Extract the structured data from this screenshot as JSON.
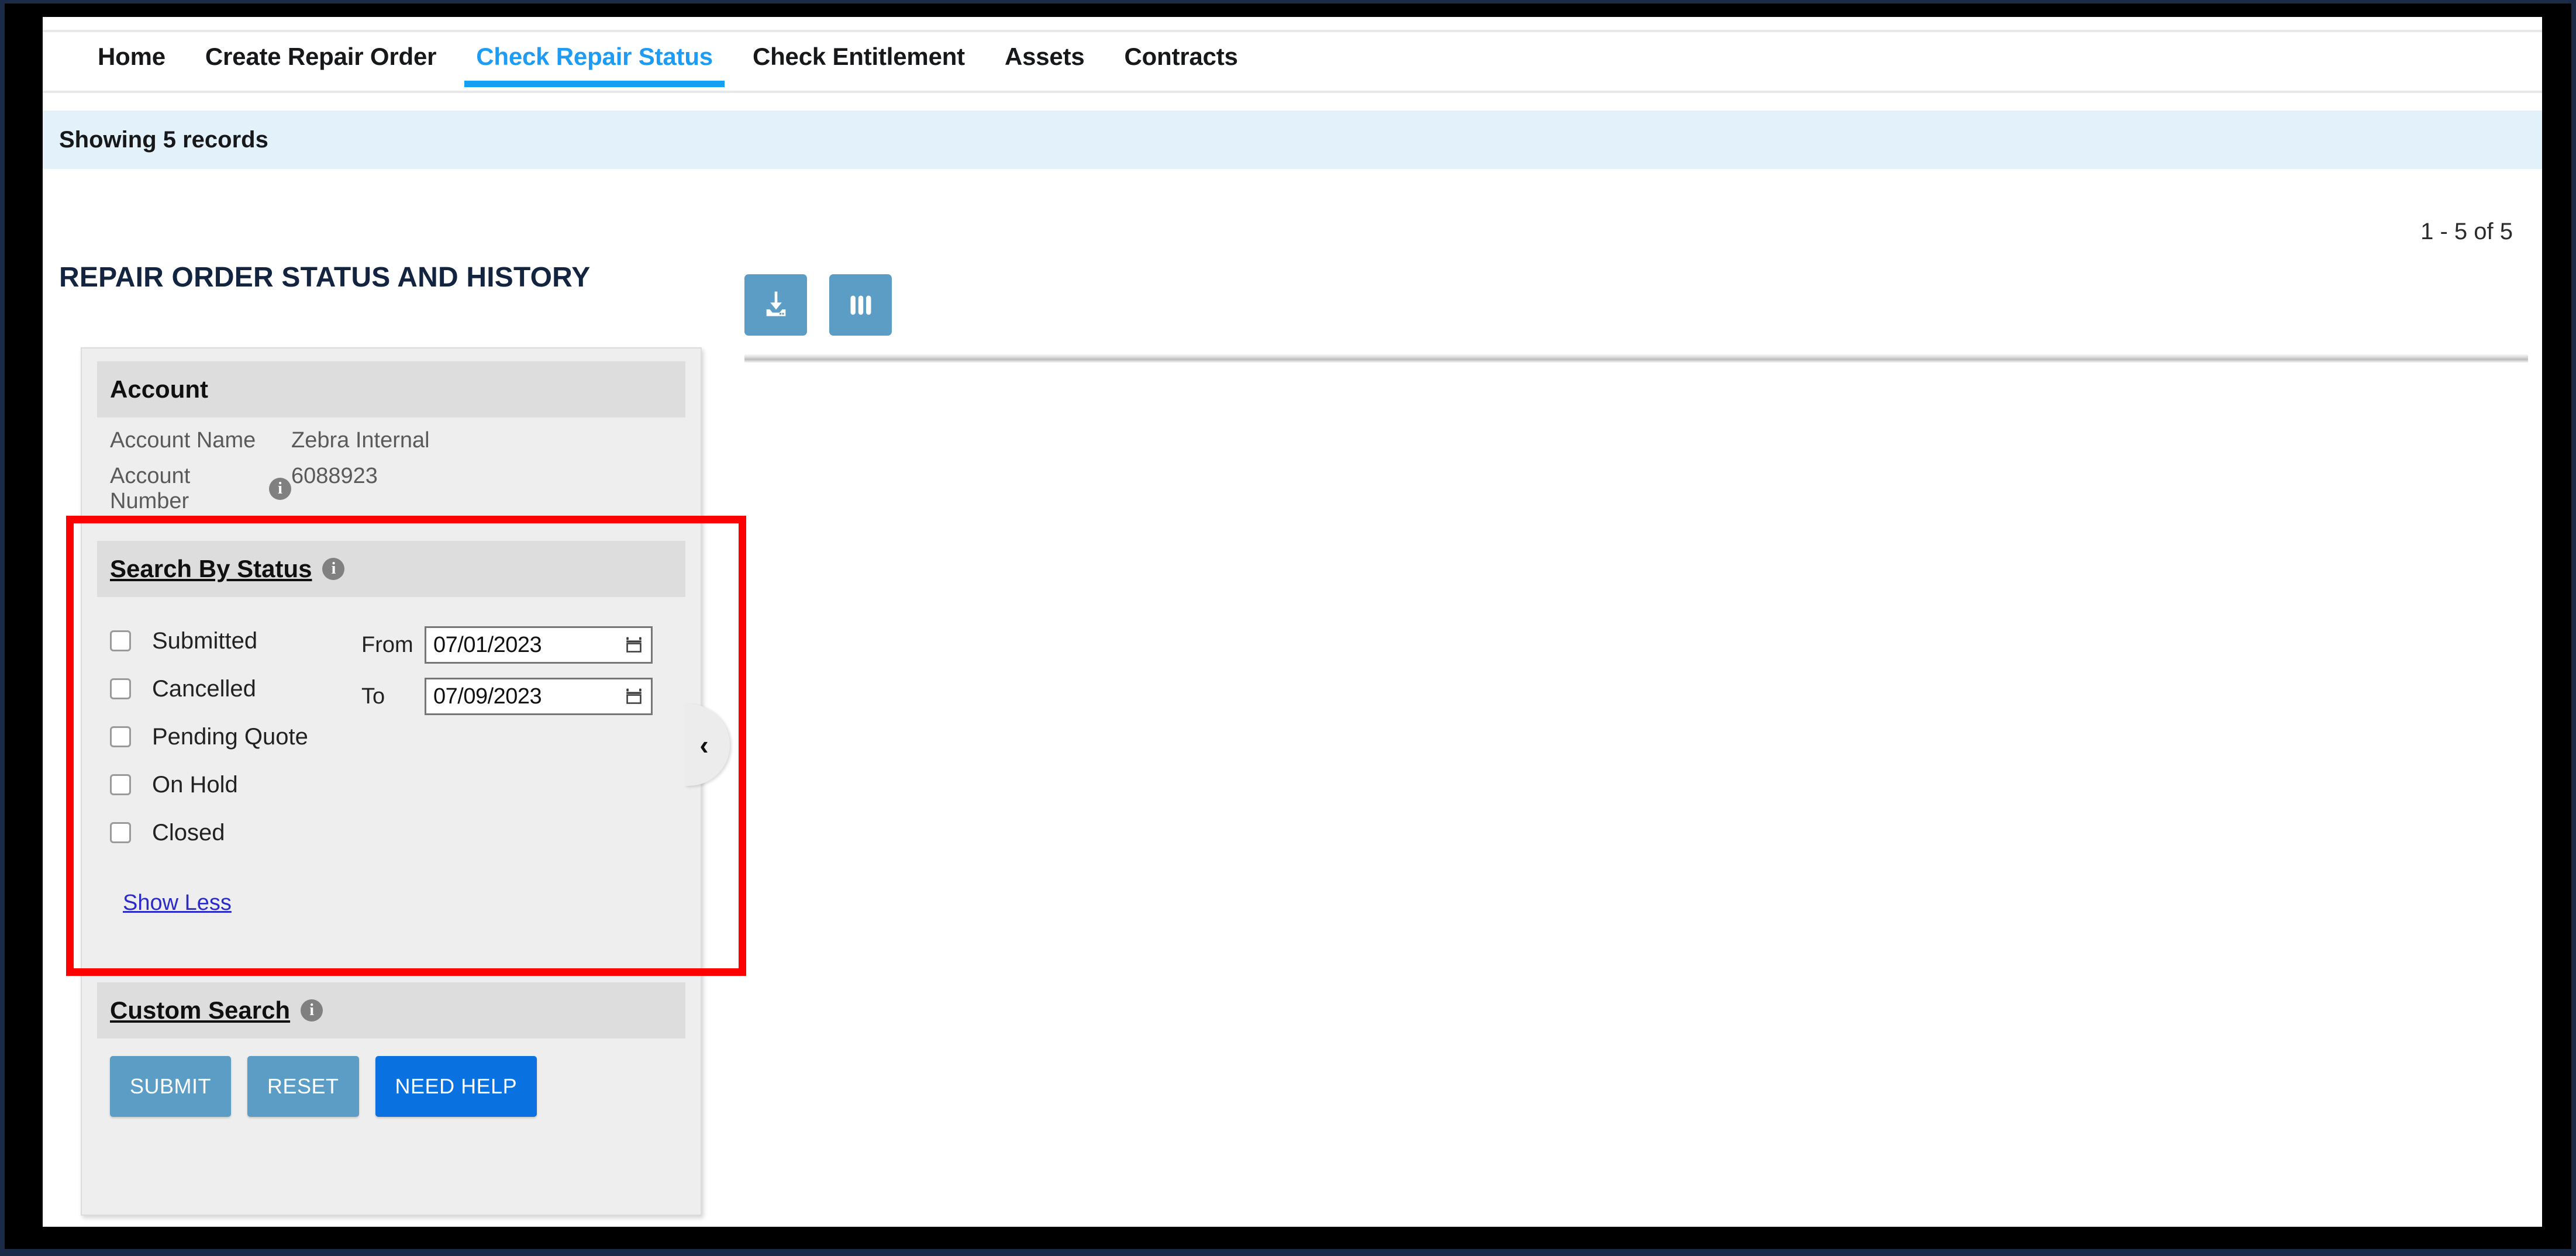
{
  "frame": {
    "outer_color": "#1b2a47",
    "inner_color": "#000000"
  },
  "nav": {
    "items": [
      {
        "label": "Home",
        "active": false
      },
      {
        "label": "Create Repair Order",
        "active": false
      },
      {
        "label": "Check Repair Status",
        "active": true
      },
      {
        "label": "Check Entitlement",
        "active": false
      },
      {
        "label": "Assets",
        "active": false
      },
      {
        "label": "Contracts",
        "active": false
      }
    ],
    "active_color": "#1e9cf5"
  },
  "banner": {
    "text": "Showing 5 records",
    "background": "#e3f1fb"
  },
  "pagination": {
    "text": "1 - 5 of 5"
  },
  "page": {
    "title": "REPAIR ORDER STATUS AND HISTORY"
  },
  "toolbar": {
    "buttons": [
      {
        "name": "download-icon",
        "tooltip": "Download"
      },
      {
        "name": "columns-icon",
        "tooltip": "Columns"
      }
    ],
    "color": "#5b9dc4"
  },
  "account_section": {
    "heading": "Account",
    "rows": [
      {
        "label": "Account Name",
        "value": "Zebra Internal",
        "has_info": false
      },
      {
        "label": "Account Number",
        "value": "6088923",
        "has_info": true
      }
    ]
  },
  "status_section": {
    "heading": "Search By Status",
    "has_info": true,
    "checkboxes": [
      {
        "label": "Submitted",
        "checked": false
      },
      {
        "label": "Cancelled",
        "checked": false
      },
      {
        "label": "Pending Quote",
        "checked": false
      },
      {
        "label": "On Hold",
        "checked": false
      },
      {
        "label": "Closed",
        "checked": false
      }
    ],
    "date_from": {
      "label": "From",
      "value": "07/01/2023"
    },
    "date_to": {
      "label": "To",
      "value": "07/09/2023"
    },
    "toggle_link": "Show Less"
  },
  "custom_search_section": {
    "heading": "Custom Search",
    "has_info": true
  },
  "actions": [
    {
      "label": "SUBMIT",
      "style": "light",
      "color": "#5b9dc4"
    },
    {
      "label": "RESET",
      "style": "light",
      "color": "#5b9dc4"
    },
    {
      "label": "NEED HELP",
      "style": "primary",
      "color": "#0a72e0"
    }
  ],
  "collapse_handle": {
    "icon": "chevron-left-icon",
    "glyph": "‹"
  },
  "annotation": {
    "type": "highlight-rectangle",
    "color": "#ff0000"
  }
}
